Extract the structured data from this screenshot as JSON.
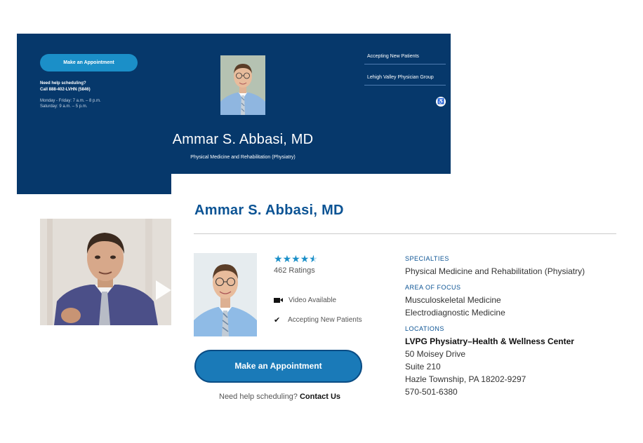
{
  "hero": {
    "appointment_label": "Make an Appointment",
    "help_line1": "Need help scheduling?",
    "help_line2": "Call 888-402-LVHN (5846)",
    "hours_weekday": "Monday - Friday: 7 a.m. – 8 p.m.",
    "hours_saturday": "Saturday: 9 a.m. – 5 p.m.",
    "name": "Ammar S. Abbasi, MD",
    "specialty": "Physical Medicine and Rehabilitation (Physiatry)",
    "links": [
      "Accepting New Patients",
      "Lehigh Valley Physician Group"
    ],
    "accessibility_icon": "accessibility-icon"
  },
  "profile": {
    "title": "Ammar S. Abbasi, MD",
    "rating": 4.5,
    "ratings_count": "462 Ratings",
    "features": {
      "video": "Video Available",
      "accepting": "Accepting New Patients"
    },
    "appointment_label": "Make an Appointment",
    "help_text": "Need help scheduling?",
    "contact_label": "Contact Us"
  },
  "details": {
    "specialties_label": "SPECIALTIES",
    "specialties": [
      "Physical Medicine and Rehabilitation (Physiatry)"
    ],
    "focus_label": "AREA OF FOCUS",
    "focus": [
      "Musculoskeletal Medicine",
      "Electrodiagnostic Medicine"
    ],
    "locations_label": "LOCATIONS",
    "location": {
      "name": "LVPG Physiatry–Health & Wellness Center",
      "street": "50 Moisey Drive",
      "suite": "Suite 210",
      "city": "Hazle Township, PA 18202-9297",
      "phone": "570-501-6380"
    }
  },
  "colors": {
    "hero_bg": "#06386b",
    "accent": "#1b8fc8",
    "title_blue": "#0b5394"
  }
}
